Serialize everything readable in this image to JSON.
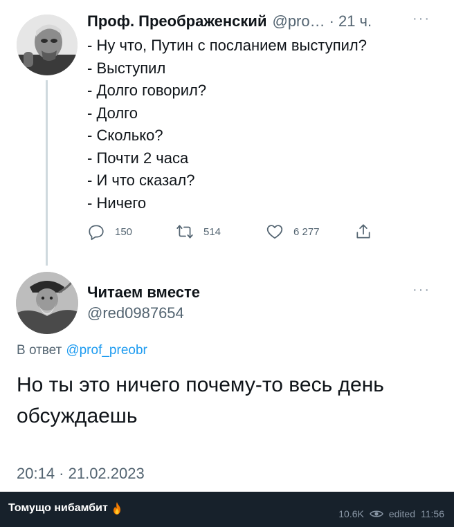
{
  "tweet": {
    "author_name": "Проф. Преображенский",
    "author_handle": "@pro…",
    "separator": "·",
    "time_ago": "21 ч.",
    "more": "···",
    "lines": [
      "- Ну что, Путин с посланием выступил?",
      "- Выступил",
      "- Долго говорил?",
      "- Долго",
      "- Сколько?",
      "- Почти 2 часа",
      "- И что сказал?",
      "- Ничего"
    ],
    "replies": "150",
    "retweets": "514",
    "likes": "6 277",
    "icons": {
      "reply": "reply-icon",
      "retweet": "retweet-icon",
      "like": "heart-icon",
      "share": "share-icon"
    }
  },
  "reply": {
    "author_name": "Читаем вместе",
    "author_handle": "@red0987654",
    "more": "···",
    "reply_to_prefix": "В ответ",
    "reply_to_mention": "@prof_preobr",
    "text": "Но ты это ничего почему-то весь день обсуждаешь",
    "timestamp": "20:14 · 21.02.2023"
  },
  "channel_post": {
    "title": "Томущо нибамбит",
    "views": "10.6K",
    "edited_label": "edited",
    "time": "11:56",
    "icons": {
      "fire": "fire-emoji-icon",
      "views": "eye-icon"
    }
  },
  "colors": {
    "text": "#0f1419",
    "secondary": "#536471",
    "link": "#1d9bf0",
    "footer_bg": "#17212b"
  }
}
